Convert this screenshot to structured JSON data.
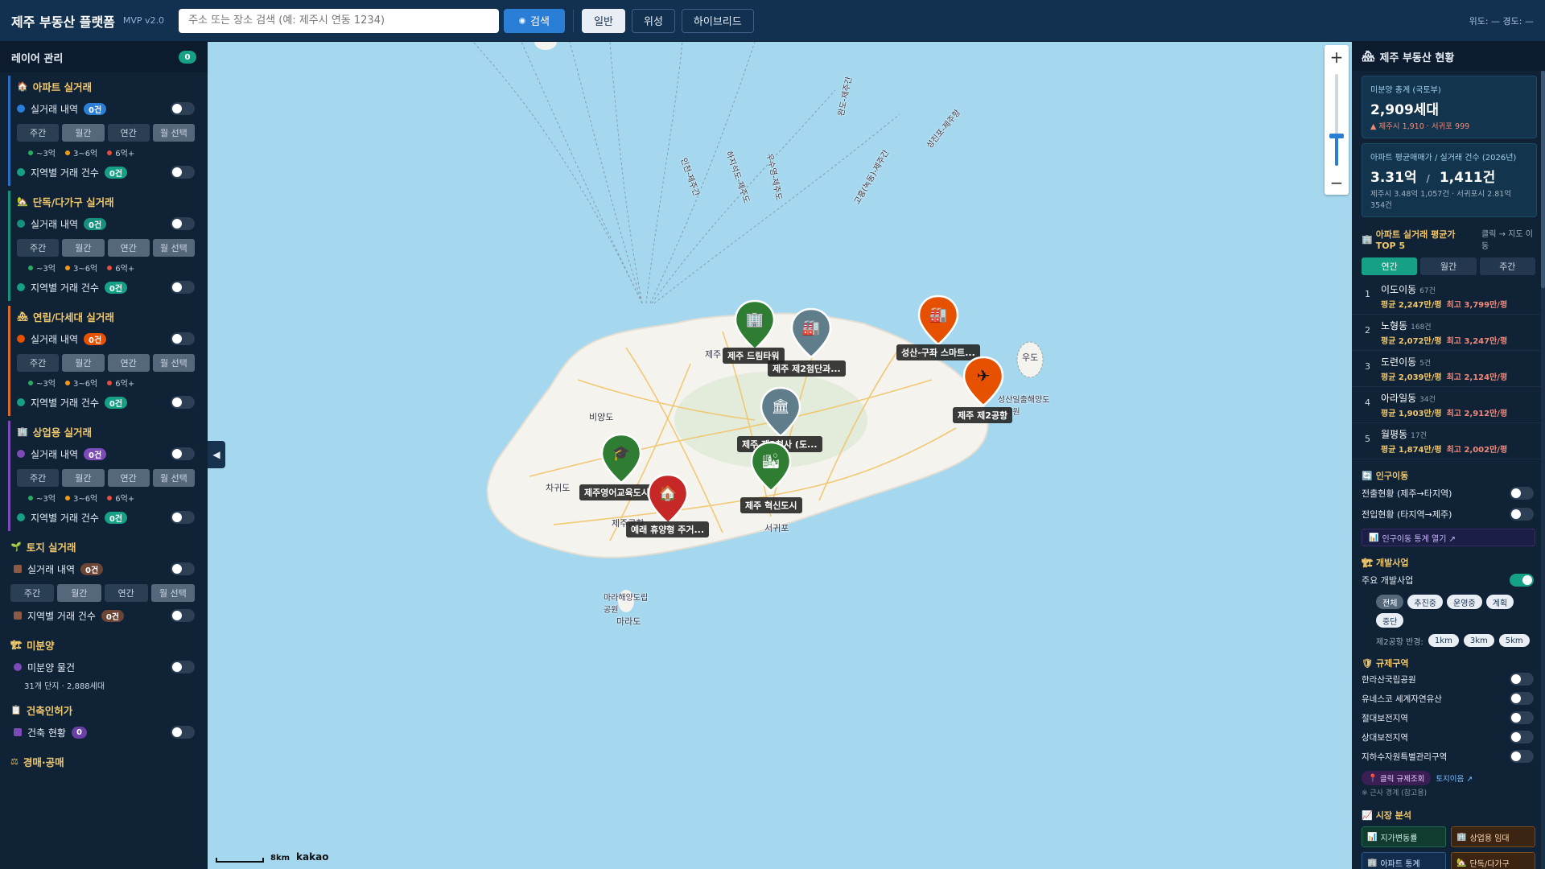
{
  "header": {
    "brand": "제주 부동산 플랫폼",
    "version": "MVP v2.0",
    "search_placeholder": "주소 또는 장소 검색 (예: 제주시 연동 1234)",
    "search_label": "검색",
    "map_types": [
      "일반",
      "위성",
      "하이브리드"
    ],
    "active_map_type": "일반",
    "coords": "위도: — 경도: —"
  },
  "sidebar": {
    "title": "레이어 관리",
    "count": "0",
    "period_buttons": [
      "주간",
      "월간",
      "연간",
      "월 선택"
    ],
    "legend": [
      "~3억",
      "3~6억",
      "6억+"
    ],
    "apt": {
      "title": "아파트 실거래",
      "trade": "실거래 내역",
      "trade_count": "0건",
      "region": "지역별 거래 건수",
      "region_count": "0건"
    },
    "house": {
      "title": "단독/다가구 실거래",
      "trade": "실거래 내역",
      "trade_count": "0건",
      "region": "지역별 거래 건수",
      "region_count": "0건"
    },
    "villa": {
      "title": "연립/다세대 실거래",
      "trade": "실거래 내역",
      "trade_count": "0건",
      "region": "지역별 거래 건수",
      "region_count": "0건"
    },
    "commercial": {
      "title": "상업용 실거래",
      "trade": "실거래 내역",
      "trade_count": "0건",
      "region": "지역별 거래 건수",
      "region_count": "0건"
    },
    "land": {
      "title": "토지 실거래",
      "trade": "실거래 내역",
      "trade_count": "0건",
      "region": "지역별 거래 건수",
      "region_count": "0건"
    },
    "unsold": {
      "title": "미분양",
      "item": "미분양 물건",
      "sub": "31개 단지 · 2,888세대"
    },
    "permit": {
      "title": "건축인허가",
      "item": "건축 현황",
      "count": "0"
    },
    "auction": {
      "title": "경매·공매"
    }
  },
  "map": {
    "collapse_icon": "◀",
    "zoom_in": "+",
    "zoom_out": "−",
    "scale": "8km",
    "logo": "kakao",
    "places": [
      "제주",
      "비양도",
      "차귀도",
      "서귀포",
      "우도",
      "마라도",
      "마라해양도립공원",
      "제주공항",
      "성산일출해양도립공원"
    ],
    "route_labels": [
      "인천-제주간",
      "하지석도-제주도",
      "우수영-제주도",
      "완도-제주간",
      "고흥(녹동)-제주간",
      "성진포-제주항"
    ],
    "markers": [
      {
        "label": "제주 드림타워",
        "color": "#2e7d32",
        "icon": "building-icon"
      },
      {
        "label": "제주 제2첨단과...",
        "color": "#607d8b",
        "icon": "factory-icon"
      },
      {
        "label": "성산-구좌 스마트...",
        "color": "#e65100",
        "icon": "factory-icon"
      },
      {
        "label": "제주 제2공항",
        "color": "#e65100",
        "icon": "airplane-icon"
      },
      {
        "label": "제주 제2청사 (도...",
        "color": "#607d8b",
        "icon": "building-icon"
      },
      {
        "label": "제주 혁신도시",
        "color": "#2e7d32",
        "icon": "city-icon"
      },
      {
        "label": "제주영어교육도시",
        "color": "#2e7d32",
        "icon": "graduation-cap-icon"
      },
      {
        "label": "예래 휴양형 주거...",
        "color": "#c62828",
        "icon": "house-icon"
      }
    ]
  },
  "right": {
    "title": "제주 부동산 현황",
    "unsold_card": {
      "k": "미분양 총계 (국토부)",
      "big": "2,909세대",
      "small": "▲ 제주시 1,910 · 서귀포 999"
    },
    "price_card": {
      "k": "아파트 평균매매가 / 실거래 건수 (2026년)",
      "big1": "3.31억",
      "slash": "/",
      "big2": "1,411건",
      "small": "제주시 3.48억 1,057건 · 서귀포시 2.81억 354건"
    },
    "top5_title": "아파트 실거래 평균가 TOP 5",
    "top5_hint": "클릭 → 지도 이동",
    "periods": [
      "연간",
      "월간",
      "주간"
    ],
    "active_period": "연간",
    "top5": [
      {
        "n": "1",
        "name": "이도이동",
        "count": "67건",
        "avg": "평균 2,247만/평",
        "max": "최고 3,799만/평"
      },
      {
        "n": "2",
        "name": "노형동",
        "count": "168건",
        "avg": "평균 2,072만/평",
        "max": "최고 3,247만/평"
      },
      {
        "n": "3",
        "name": "도련이동",
        "count": "5건",
        "avg": "평균 2,039만/평",
        "max": "최고 2,124만/평"
      },
      {
        "n": "4",
        "name": "아라일동",
        "count": "34건",
        "avg": "평균 1,903만/평",
        "max": "최고 2,912만/평"
      },
      {
        "n": "5",
        "name": "월평동",
        "count": "17건",
        "avg": "평균 1,874만/평",
        "max": "최고 2,002만/평"
      }
    ],
    "pop": {
      "title": "인구이동",
      "out": "전출현황 (제주→타지역)",
      "in": "전입현황 (타지역→제주)",
      "link": "인구이동 통계 열기 ↗"
    },
    "dev": {
      "title": "개발사업",
      "main": "주요 개발사업",
      "chips": [
        "전체",
        "추진중",
        "운영중",
        "계획",
        "중단"
      ],
      "active_chip": "전체",
      "radius_label": "제2공항 반경:",
      "radius": [
        "1km",
        "3km",
        "5km"
      ]
    },
    "reg": {
      "title": "규제구역",
      "items": [
        "한라산국립공원",
        "유네스코 세계자연유산",
        "절대보전지역",
        "상대보전지역",
        "지하수자원특별관리구역"
      ],
      "btn": "클릭 규제조회",
      "link": "토지이음 ↗",
      "note": "※ 근사 경계 (참고용)"
    },
    "ma": {
      "title": "시장 분석",
      "btns": [
        "지가변동률",
        "상업용 임대",
        "아파트 통계",
        "단독/다가구"
      ]
    }
  },
  "colors": {
    "accent": "#16a085",
    "blue": "#2a7ed6",
    "orange": "#e65100",
    "purple": "#7d4bb8",
    "land": "#a0522d"
  }
}
